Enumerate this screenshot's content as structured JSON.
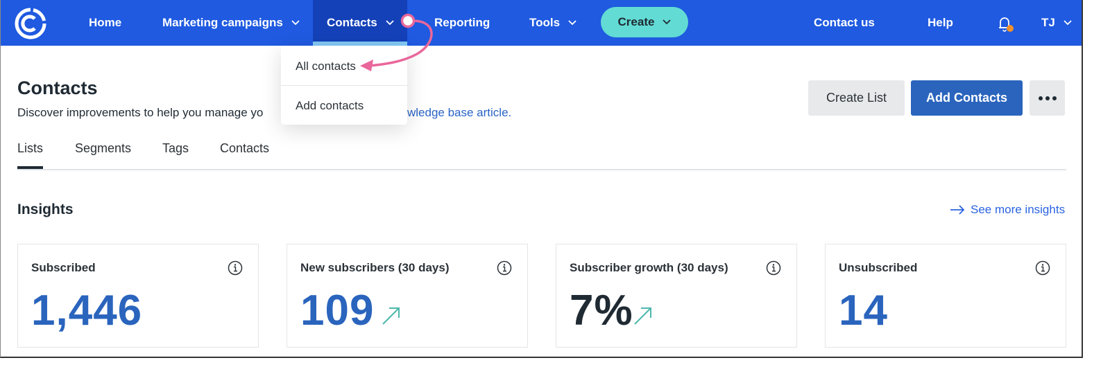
{
  "nav": {
    "logo": "constant-contact-logo-icon",
    "items": [
      {
        "label": "Home",
        "has_dropdown": false
      },
      {
        "label": "Marketing campaigns",
        "has_dropdown": true
      },
      {
        "label": "Contacts",
        "has_dropdown": true,
        "active": true
      },
      {
        "label": "Reporting",
        "has_dropdown": false
      },
      {
        "label": "Tools",
        "has_dropdown": true
      }
    ],
    "create_label": "Create",
    "right_items": [
      {
        "label": "Contact us"
      },
      {
        "label": "Help"
      }
    ],
    "bell_icon": "bell-icon",
    "notification_dot_color": "#f0902a",
    "user_initials": "TJ",
    "colors": {
      "bar": "#1f5ae0",
      "active": "#1441b8",
      "active_underline": "#82c8f3",
      "create": "#62dbd4"
    }
  },
  "contacts_dropdown": {
    "items": [
      {
        "label": "All contacts"
      },
      {
        "label": "Add contacts"
      }
    ]
  },
  "header": {
    "title": "Contacts",
    "subtitle_visible_prefix": "Discover improvements to help you manage yo",
    "subtitle_visible_link": "wledge base article.",
    "create_list_label": "Create List",
    "add_contacts_label": "Add Contacts",
    "more_icon": "more-horizontal-icon"
  },
  "tabs": [
    {
      "label": "Lists",
      "active": true
    },
    {
      "label": "Segments"
    },
    {
      "label": "Tags"
    },
    {
      "label": "Contacts"
    }
  ],
  "insights": {
    "title": "Insights",
    "see_more_label": "See more insights",
    "cards": [
      {
        "label": "Subscribed",
        "value": "1,446",
        "trend": null,
        "value_color": "#2a64bd"
      },
      {
        "label": "New subscribers (30 days)",
        "value": "109",
        "trend": "up",
        "value_color": "#2a64bd"
      },
      {
        "label": "Subscriber growth (30 days)",
        "value": "7%",
        "trend": "up",
        "value_color": "#1f2a33"
      },
      {
        "label": "Unsubscribed",
        "value": "14",
        "trend": null,
        "value_color": "#2a64bd"
      }
    ]
  },
  "annotation": {
    "type": "arrow",
    "color": "#e9679b",
    "from": "contacts-nav-dropdown",
    "to": "all-contacts-menu-item"
  }
}
